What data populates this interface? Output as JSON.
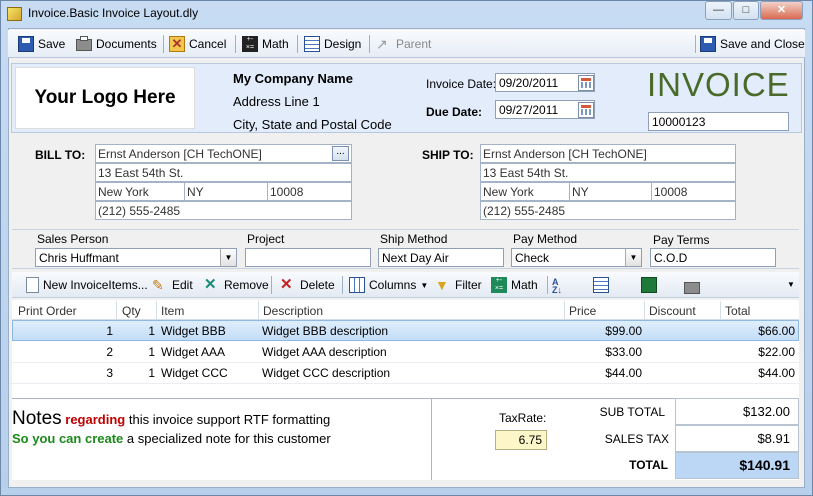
{
  "window": {
    "title": "Invoice.Basic Invoice Layout.dly",
    "min": "—",
    "max": "□",
    "close": "✕"
  },
  "toolbar": {
    "save": "Save",
    "documents": "Documents",
    "cancel": "Cancel",
    "math": "Math",
    "design": "Design",
    "parent": "Parent",
    "save_close": "Save and Close"
  },
  "header": {
    "logo": "Your Logo Here",
    "company_name": "My Company Name",
    "address1": "Address Line 1",
    "address2": "City, State and Postal Code",
    "invoice_date_label": "Invoice Date:",
    "invoice_date": "09/20/2011",
    "due_date_label": "Due Date:",
    "due_date": "09/27/2011",
    "invoice_title": "INVOICE",
    "invoice_number": "10000123"
  },
  "bill_to": {
    "label": "BILL TO:",
    "name": "Ernst Anderson [CH TechONE]",
    "browse": "...",
    "street": "13 East 54th St.",
    "city": "New York",
    "state": "NY",
    "zip": "10008",
    "phone": "(212) 555-2485"
  },
  "ship_to": {
    "label": "SHIP TO:",
    "name": "Ernst Anderson [CH TechONE]",
    "street": "13 East 54th St.",
    "city": "New York",
    "state": "NY",
    "zip": "10008",
    "phone": "(212) 555-2485"
  },
  "order_fields": {
    "sales_person_label": "Sales Person",
    "sales_person": "Chris Huffmant",
    "project_label": "Project",
    "project": "",
    "ship_method_label": "Ship Method",
    "ship_method": "Next Day Air",
    "pay_method_label": "Pay Method",
    "pay_method": "Check",
    "pay_terms_label": "Pay Terms",
    "pay_terms": "C.O.D"
  },
  "items_toolbar": {
    "new": "New InvoiceItems...",
    "edit": "Edit",
    "remove": "Remove",
    "delete": "Delete",
    "columns": "Columns",
    "filter": "Filter",
    "math": "Math"
  },
  "table": {
    "columns": [
      "Print Order",
      "Qty",
      "Item",
      "Description",
      "Price",
      "Discount",
      "Total"
    ],
    "rows": [
      {
        "order": "1",
        "qty": "1",
        "item": "Widget BBB",
        "desc": "Widget BBB  description",
        "price": "$99.00",
        "discount": "",
        "total": "$66.00"
      },
      {
        "order": "2",
        "qty": "1",
        "item": "Widget AAA",
        "desc": "Widget AAA  description",
        "price": "$33.00",
        "discount": "",
        "total": "$22.00"
      },
      {
        "order": "3",
        "qty": "1",
        "item": "Widget CCC",
        "desc": "Widget CCC description",
        "price": "$44.00",
        "discount": "",
        "total": "$44.00"
      }
    ]
  },
  "notes": {
    "big": "Notes",
    "red": "regarding",
    "rest1": " this invoice support RTF formatting",
    "green": "So you can create",
    "rest2": " a specialized note for this customer"
  },
  "totals": {
    "taxrate_label": "TaxRate:",
    "taxrate": "6.75",
    "subtotal_label": "SUB TOTAL",
    "subtotal": "$132.00",
    "salestax_label": "SALES TAX",
    "salestax": "$8.91",
    "total_label": "TOTAL",
    "total": "$140.91"
  },
  "colors": {
    "accent": "#4a6a2a",
    "red": "#c00000",
    "green": "#1a8a1a",
    "selection": "#c3ddf7",
    "total_bg": "#bcd6f5"
  }
}
